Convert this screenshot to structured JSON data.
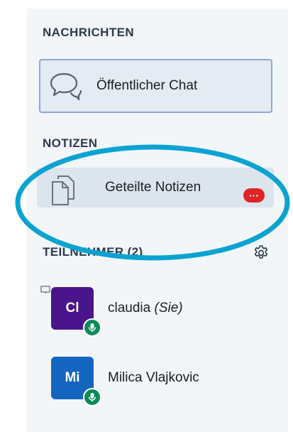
{
  "sidebar": {
    "messages_title": "NACHRICHTEN",
    "public_chat_label": "Öffentlicher Chat",
    "notes_title": "NOTIZEN",
    "shared_notes_label": "Geteilte Notizen",
    "shared_notes_badge": "···",
    "participants_title": "TEILNEHMER (2)",
    "users": [
      {
        "initials": "Cl",
        "name": "claudia",
        "suffix": " (Sie)",
        "color": "#4a148c"
      },
      {
        "initials": "Mi",
        "name": "Milica Vlajkovic",
        "suffix": "",
        "color": "#1565c0"
      }
    ]
  },
  "colors": {
    "highlight_ring": "#0aa3d1",
    "badge": "#e02323",
    "mic": "#0b8a5a"
  }
}
